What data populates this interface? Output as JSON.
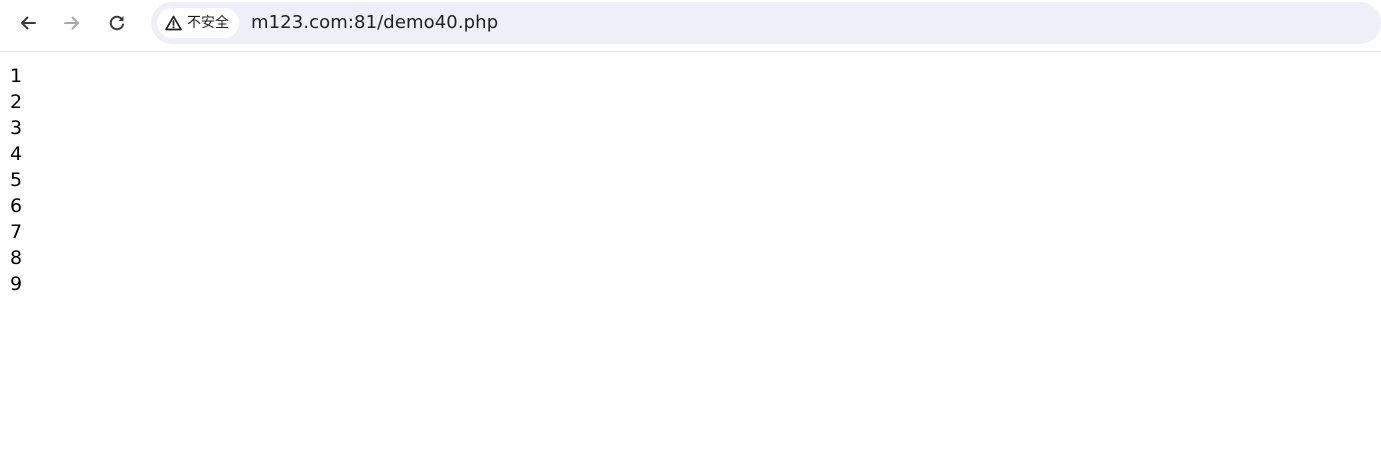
{
  "browser": {
    "back_icon": "arrow-left-icon",
    "forward_icon": "arrow-right-icon",
    "reload_icon": "reload-icon",
    "security": {
      "icon": "warning-triangle-icon",
      "label": "不安全"
    },
    "url": "m123.com:81/demo40.php",
    "omnibox_color": "#edf0f8"
  },
  "page": {
    "lines": [
      "1",
      "2",
      "3",
      "4",
      "5",
      "6",
      "7",
      "8",
      "9"
    ]
  }
}
